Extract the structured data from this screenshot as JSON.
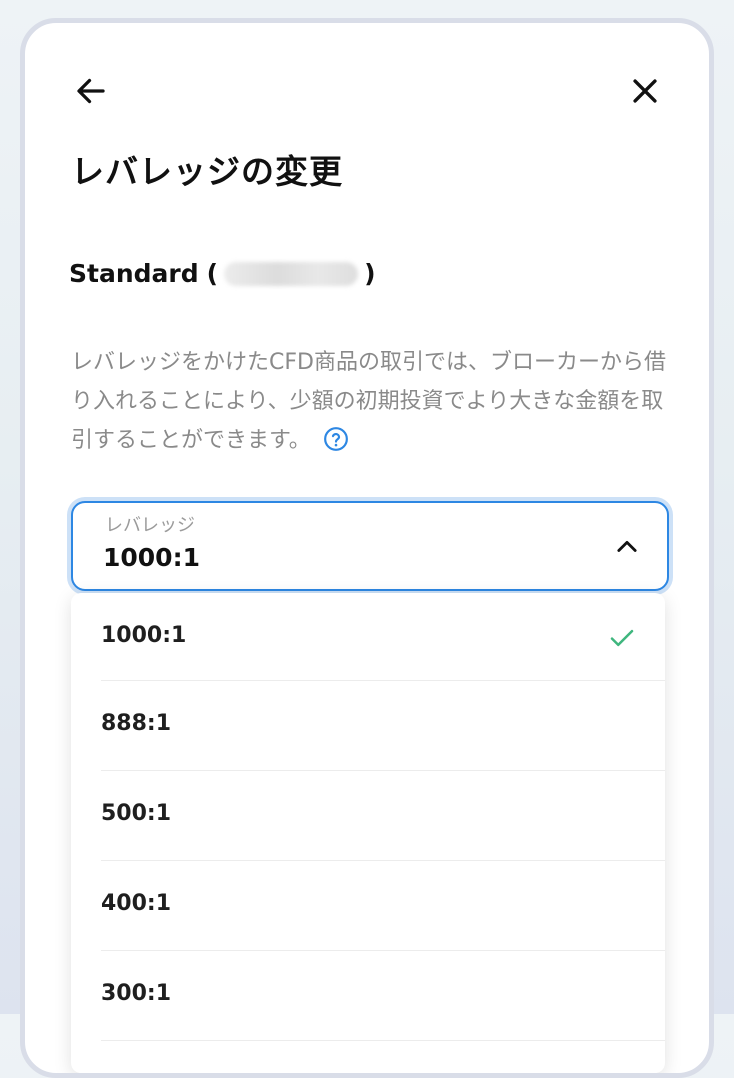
{
  "header": {
    "back_icon": "arrow-left-icon",
    "close_icon": "close-icon",
    "title": "レバレッジの変更"
  },
  "account": {
    "type": "Standard",
    "open_paren": "(",
    "close_paren": ")"
  },
  "description": {
    "text": "レバレッジをかけたCFD商品の取引では、ブローカーから借り入れることにより、少額の初期投資でより大きな金額を取引することができます。",
    "help_icon": "question-circle-icon"
  },
  "leverage_select": {
    "label": "レバレッジ",
    "value": "1000:1",
    "expanded": true,
    "options": [
      {
        "label": "1000:1",
        "selected": true
      },
      {
        "label": "888:1",
        "selected": false
      },
      {
        "label": "500:1",
        "selected": false
      },
      {
        "label": "400:1",
        "selected": false
      },
      {
        "label": "300:1",
        "selected": false
      }
    ]
  },
  "colors": {
    "accent": "#2d87e3",
    "check": "#3fb67e",
    "muted_text": "#8a8a8a"
  }
}
